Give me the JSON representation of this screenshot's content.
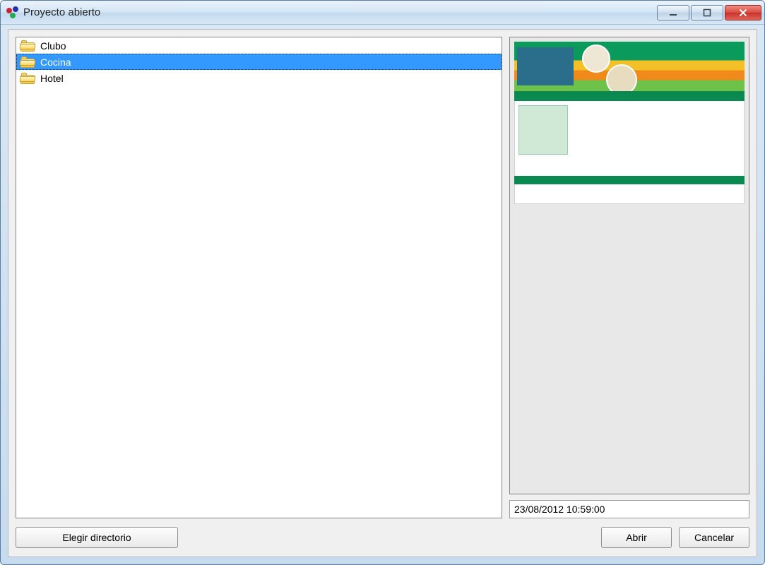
{
  "window": {
    "title": "Proyecto abierto"
  },
  "projects": [
    {
      "name": "Clubo",
      "selected": false
    },
    {
      "name": "Cocina",
      "selected": true
    },
    {
      "name": "Hotel",
      "selected": false
    }
  ],
  "preview": {
    "timestamp": "23/08/2012 10:59:00"
  },
  "buttons": {
    "choose_dir": "Elegir directorio",
    "open": "Abrir",
    "cancel": "Cancelar"
  }
}
